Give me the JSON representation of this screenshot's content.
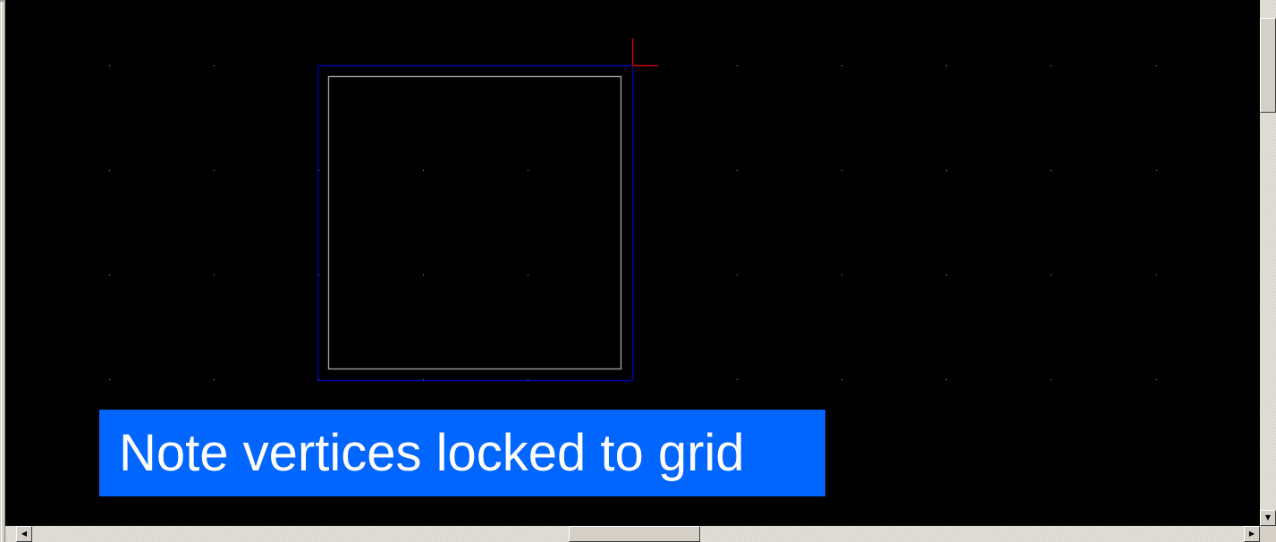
{
  "annotation": {
    "text": "Note vertices locked to grid"
  },
  "canvas": {
    "background_color": "#000000",
    "grid_dot_color": "#9a9a9a",
    "selection_box_color": "#0000b0",
    "shape_outline_color": "#9c9c9c",
    "cursor_color": "#cc0000"
  },
  "icons": {
    "scroll_up": "arrow-up-icon",
    "scroll_down": "arrow-down-icon",
    "scroll_left": "arrow-left-icon",
    "scroll_right": "arrow-right-icon",
    "down_glyph": "▼",
    "left_glyph": "◀",
    "right_glyph": "▶"
  },
  "colors": {
    "annotation_bg": "#0066ff",
    "annotation_text": "#ffffff",
    "chrome": "#d4d0c8"
  }
}
